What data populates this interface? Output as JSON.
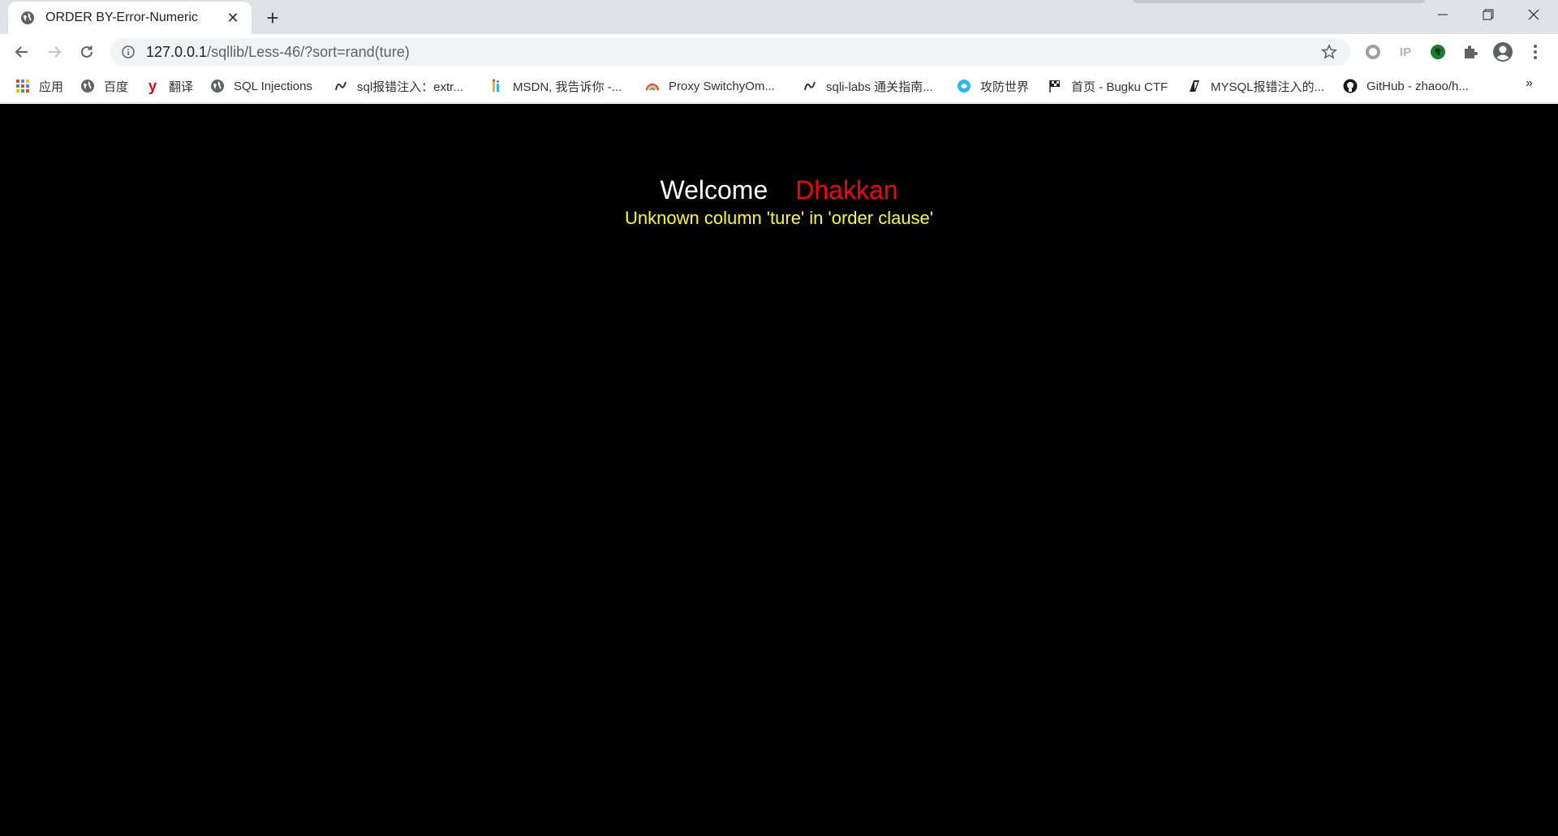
{
  "tab": {
    "title": "ORDER BY-Error-Numeric",
    "close": "✕",
    "new_tab": "+"
  },
  "window": {
    "minimize": "—",
    "restore": "❐",
    "close": "✕"
  },
  "address": {
    "host": "127.0.0.1",
    "path": "/sqllib/Less-46/?sort=rand(ture)"
  },
  "extensions": {
    "ip_label": "IP"
  },
  "bookmarks": [
    {
      "label": "应用",
      "icon": "apps-grid-icon"
    },
    {
      "label": "百度",
      "icon": "globe-icon"
    },
    {
      "label": "翻译",
      "icon": "youdao-icon"
    },
    {
      "label": "SQL Injections",
      "icon": "globe-icon"
    },
    {
      "label": "sql报错注入：extr...",
      "icon": "swirl-icon"
    },
    {
      "label": "MSDN, 我告诉你 -...",
      "icon": "msdn-icon"
    },
    {
      "label": "Proxy SwitchyOm...",
      "icon": "rainbow-icon"
    },
    {
      "label": "sqli-labs 通关指南...",
      "icon": "swirl-icon"
    },
    {
      "label": "攻防世界",
      "icon": "cyber-icon"
    },
    {
      "label": "首页 - Bugku CTF",
      "icon": "flag-icon"
    },
    {
      "label": "MYSQL报错注入的...",
      "icon": "slash-icon"
    },
    {
      "label": "GitHub - zhaoo/h...",
      "icon": "github-icon"
    }
  ],
  "more_bookmarks": "»",
  "page": {
    "welcome": "Welcome",
    "user": "Dhakkan",
    "error": "Unknown column 'ture' in 'order clause'"
  },
  "colors": {
    "background": "#000000",
    "welcome": "#ffffff",
    "user": "#ff0000",
    "error": "#ffff00"
  }
}
